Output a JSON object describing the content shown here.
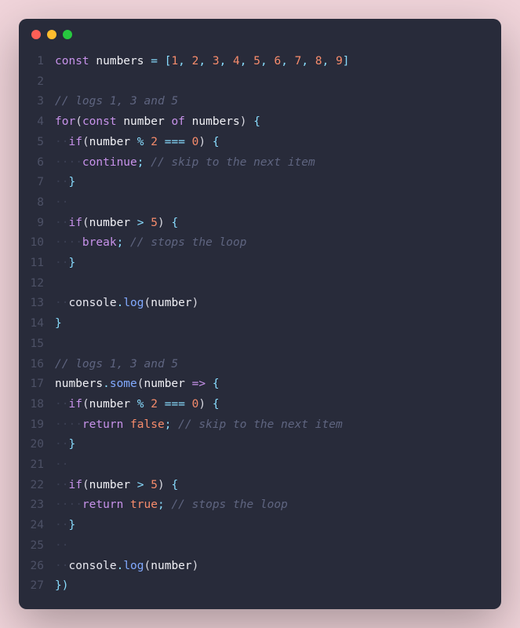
{
  "colors": {
    "background": "#f0d4da",
    "editor_bg": "#282b3a",
    "gutter": "#4d5166",
    "keyword": "#c792ea",
    "operator": "#89ddff",
    "number": "#f78c6c",
    "comment": "#5f6580",
    "function": "#82aaff",
    "text": "#d8d8e0",
    "whitespace": "#3a3e52"
  },
  "window": {
    "traffic_lights": [
      "red",
      "yellow",
      "green"
    ]
  },
  "line_numbers": [
    "1",
    "2",
    "3",
    "4",
    "5",
    "6",
    "7",
    "8",
    "9",
    "10",
    "11",
    "12",
    "13",
    "14",
    "15",
    "16",
    "17",
    "18",
    "19",
    "20",
    "21",
    "22",
    "23",
    "24",
    "25",
    "26",
    "27"
  ],
  "code_lines": [
    [
      {
        "t": "const",
        "c": "kw"
      },
      {
        "t": " ",
        "c": ""
      },
      {
        "t": "numbers",
        "c": "ident"
      },
      {
        "t": " ",
        "c": ""
      },
      {
        "t": "=",
        "c": "op"
      },
      {
        "t": " ",
        "c": ""
      },
      {
        "t": "[",
        "c": "punct"
      },
      {
        "t": "1",
        "c": "num"
      },
      {
        "t": ",",
        "c": "punct"
      },
      {
        "t": " ",
        "c": ""
      },
      {
        "t": "2",
        "c": "num"
      },
      {
        "t": ",",
        "c": "punct"
      },
      {
        "t": " ",
        "c": ""
      },
      {
        "t": "3",
        "c": "num"
      },
      {
        "t": ",",
        "c": "punct"
      },
      {
        "t": " ",
        "c": ""
      },
      {
        "t": "4",
        "c": "num"
      },
      {
        "t": ",",
        "c": "punct"
      },
      {
        "t": " ",
        "c": ""
      },
      {
        "t": "5",
        "c": "num"
      },
      {
        "t": ",",
        "c": "punct"
      },
      {
        "t": " ",
        "c": ""
      },
      {
        "t": "6",
        "c": "num"
      },
      {
        "t": ",",
        "c": "punct"
      },
      {
        "t": " ",
        "c": ""
      },
      {
        "t": "7",
        "c": "num"
      },
      {
        "t": ",",
        "c": "punct"
      },
      {
        "t": " ",
        "c": ""
      },
      {
        "t": "8",
        "c": "num"
      },
      {
        "t": ",",
        "c": "punct"
      },
      {
        "t": " ",
        "c": ""
      },
      {
        "t": "9",
        "c": "num"
      },
      {
        "t": "]",
        "c": "punct"
      }
    ],
    [],
    [
      {
        "t": "// logs 1, 3 and 5",
        "c": "comment"
      }
    ],
    [
      {
        "t": "for",
        "c": "kw"
      },
      {
        "t": "(",
        "c": "paren"
      },
      {
        "t": "const",
        "c": "kw"
      },
      {
        "t": " ",
        "c": ""
      },
      {
        "t": "number",
        "c": "ident"
      },
      {
        "t": " ",
        "c": ""
      },
      {
        "t": "of",
        "c": "kw"
      },
      {
        "t": " ",
        "c": ""
      },
      {
        "t": "numbers",
        "c": "ident"
      },
      {
        "t": ")",
        "c": "paren"
      },
      {
        "t": " ",
        "c": ""
      },
      {
        "t": "{",
        "c": "punct"
      }
    ],
    [
      {
        "t": "··",
        "c": "ws"
      },
      {
        "t": "if",
        "c": "kw"
      },
      {
        "t": "(",
        "c": "paren"
      },
      {
        "t": "number",
        "c": "ident"
      },
      {
        "t": " ",
        "c": ""
      },
      {
        "t": "%",
        "c": "op"
      },
      {
        "t": " ",
        "c": ""
      },
      {
        "t": "2",
        "c": "num"
      },
      {
        "t": " ",
        "c": ""
      },
      {
        "t": "===",
        "c": "op"
      },
      {
        "t": " ",
        "c": ""
      },
      {
        "t": "0",
        "c": "num"
      },
      {
        "t": ")",
        "c": "paren"
      },
      {
        "t": " ",
        "c": ""
      },
      {
        "t": "{",
        "c": "punct"
      }
    ],
    [
      {
        "t": "····",
        "c": "ws"
      },
      {
        "t": "continue",
        "c": "kw"
      },
      {
        "t": ";",
        "c": "punct"
      },
      {
        "t": " ",
        "c": ""
      },
      {
        "t": "// skip to the next item",
        "c": "comment"
      }
    ],
    [
      {
        "t": "··",
        "c": "ws"
      },
      {
        "t": "}",
        "c": "punct"
      }
    ],
    [
      {
        "t": "··",
        "c": "ws"
      }
    ],
    [
      {
        "t": "··",
        "c": "ws"
      },
      {
        "t": "if",
        "c": "kw"
      },
      {
        "t": "(",
        "c": "paren"
      },
      {
        "t": "number",
        "c": "ident"
      },
      {
        "t": " ",
        "c": ""
      },
      {
        "t": ">",
        "c": "op"
      },
      {
        "t": " ",
        "c": ""
      },
      {
        "t": "5",
        "c": "num"
      },
      {
        "t": ")",
        "c": "paren"
      },
      {
        "t": " ",
        "c": ""
      },
      {
        "t": "{",
        "c": "punct"
      }
    ],
    [
      {
        "t": "····",
        "c": "ws"
      },
      {
        "t": "break",
        "c": "kw"
      },
      {
        "t": ";",
        "c": "punct"
      },
      {
        "t": " ",
        "c": ""
      },
      {
        "t": "// stops the loop",
        "c": "comment"
      }
    ],
    [
      {
        "t": "··",
        "c": "ws"
      },
      {
        "t": "}",
        "c": "punct"
      }
    ],
    [],
    [
      {
        "t": "··",
        "c": "ws"
      },
      {
        "t": "console",
        "c": "prop"
      },
      {
        "t": ".",
        "c": "punct"
      },
      {
        "t": "log",
        "c": "func"
      },
      {
        "t": "(",
        "c": "paren"
      },
      {
        "t": "number",
        "c": "ident"
      },
      {
        "t": ")",
        "c": "paren"
      }
    ],
    [
      {
        "t": "}",
        "c": "punct"
      }
    ],
    [],
    [
      {
        "t": "// logs 1, 3 and 5",
        "c": "comment"
      }
    ],
    [
      {
        "t": "numbers",
        "c": "ident"
      },
      {
        "t": ".",
        "c": "punct"
      },
      {
        "t": "some",
        "c": "func"
      },
      {
        "t": "(",
        "c": "paren"
      },
      {
        "t": "number",
        "c": "ident"
      },
      {
        "t": " ",
        "c": ""
      },
      {
        "t": "=>",
        "c": "kw"
      },
      {
        "t": " ",
        "c": ""
      },
      {
        "t": "{",
        "c": "punct"
      }
    ],
    [
      {
        "t": "··",
        "c": "ws"
      },
      {
        "t": "if",
        "c": "kw"
      },
      {
        "t": "(",
        "c": "paren"
      },
      {
        "t": "number",
        "c": "ident"
      },
      {
        "t": " ",
        "c": ""
      },
      {
        "t": "%",
        "c": "op"
      },
      {
        "t": " ",
        "c": ""
      },
      {
        "t": "2",
        "c": "num"
      },
      {
        "t": " ",
        "c": ""
      },
      {
        "t": "===",
        "c": "op"
      },
      {
        "t": " ",
        "c": ""
      },
      {
        "t": "0",
        "c": "num"
      },
      {
        "t": ")",
        "c": "paren"
      },
      {
        "t": " ",
        "c": ""
      },
      {
        "t": "{",
        "c": "punct"
      }
    ],
    [
      {
        "t": "····",
        "c": "ws"
      },
      {
        "t": "return",
        "c": "kw"
      },
      {
        "t": " ",
        "c": ""
      },
      {
        "t": "false",
        "c": "num"
      },
      {
        "t": ";",
        "c": "punct"
      },
      {
        "t": " ",
        "c": ""
      },
      {
        "t": "// skip to the next item",
        "c": "comment"
      }
    ],
    [
      {
        "t": "··",
        "c": "ws"
      },
      {
        "t": "}",
        "c": "punct"
      }
    ],
    [
      {
        "t": "··",
        "c": "ws"
      }
    ],
    [
      {
        "t": "··",
        "c": "ws"
      },
      {
        "t": "if",
        "c": "kw"
      },
      {
        "t": "(",
        "c": "paren"
      },
      {
        "t": "number",
        "c": "ident"
      },
      {
        "t": " ",
        "c": ""
      },
      {
        "t": ">",
        "c": "op"
      },
      {
        "t": " ",
        "c": ""
      },
      {
        "t": "5",
        "c": "num"
      },
      {
        "t": ")",
        "c": "paren"
      },
      {
        "t": " ",
        "c": ""
      },
      {
        "t": "{",
        "c": "punct"
      }
    ],
    [
      {
        "t": "····",
        "c": "ws"
      },
      {
        "t": "return",
        "c": "kw"
      },
      {
        "t": " ",
        "c": ""
      },
      {
        "t": "true",
        "c": "num"
      },
      {
        "t": ";",
        "c": "punct"
      },
      {
        "t": " ",
        "c": ""
      },
      {
        "t": "// stops the loop",
        "c": "comment"
      }
    ],
    [
      {
        "t": "··",
        "c": "ws"
      },
      {
        "t": "}",
        "c": "punct"
      }
    ],
    [
      {
        "t": "··",
        "c": "ws"
      }
    ],
    [
      {
        "t": "··",
        "c": "ws"
      },
      {
        "t": "console",
        "c": "prop"
      },
      {
        "t": ".",
        "c": "punct"
      },
      {
        "t": "log",
        "c": "func"
      },
      {
        "t": "(",
        "c": "paren"
      },
      {
        "t": "number",
        "c": "ident"
      },
      {
        "t": ")",
        "c": "paren"
      }
    ],
    [
      {
        "t": "})",
        "c": "punct"
      }
    ]
  ]
}
